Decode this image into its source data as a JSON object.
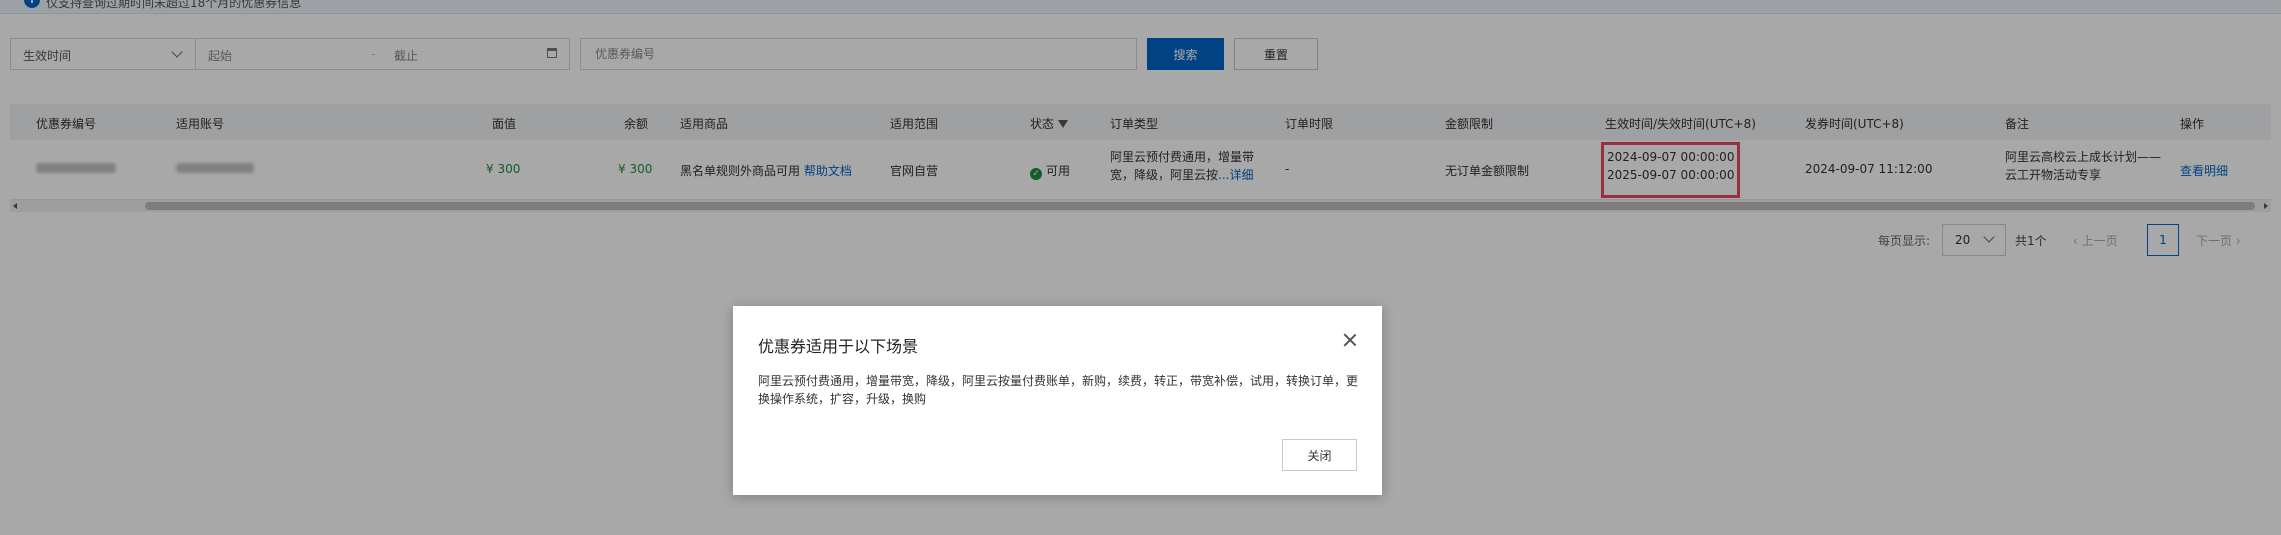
{
  "notice": {
    "text": "仅支持查询过期时间未超过18个月的优惠券信息"
  },
  "filters": {
    "time_type": "生效时间",
    "start_placeholder": "起始",
    "range_sep": "-",
    "end_placeholder": "截止",
    "coupon_placeholder": "优惠券编号",
    "search_label": "搜索",
    "reset_label": "重置"
  },
  "table": {
    "columns": [
      "优惠券编号",
      "适用账号",
      "面值",
      "余额",
      "适用商品",
      "适用范围",
      "状态",
      "订单类型",
      "订单时限",
      "金额限制",
      "生效时间/失效时间(UTC+8)",
      "发券时间(UTC+8)",
      "备注",
      "操作"
    ],
    "row": {
      "face_value": "¥ 300",
      "balance": "¥ 300",
      "product": "黑名单规则外商品可用",
      "help_link": "帮助文档",
      "scope": "官网自营",
      "status": "可用",
      "order_type_line1": "阿里云预付费通用，增量带",
      "order_type_line2": "宽，降级，阿里云按",
      "order_type_more": "...详细",
      "order_limit": "-",
      "amount_limit": "无订单金额限制",
      "effective_time": "2024-09-07 00:00:00",
      "expire_time": "2025-09-07 00:00:00",
      "issue_time": "2024-09-07 11:12:00",
      "remark_line1": "阿里云高校云上成长计划——",
      "remark_line2": "云工开物活动专享",
      "action": "查看明细"
    }
  },
  "pagination": {
    "per_page_label": "每页显示:",
    "per_page": "20",
    "total": "共1个",
    "prev": "上一页",
    "current": "1",
    "next": "下一页"
  },
  "modal": {
    "title": "优惠券适用于以下场景",
    "body": "阿里云预付费通用，增量带宽，降级，阿里云按量付费账单，新购，续费，转正，带宽补偿，试用，转换订单，更换操作系统，扩容，升级，换购",
    "close_label": "关闭"
  },
  "colors": {
    "primary": "#0064c8",
    "green": "#1e8e3e",
    "highlight": "#e84a5f"
  }
}
